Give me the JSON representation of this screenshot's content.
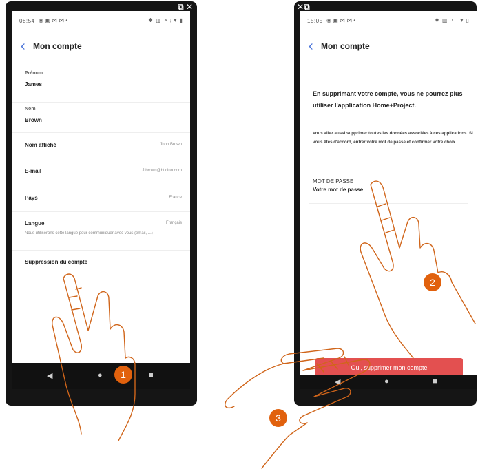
{
  "left_screen": {
    "status_time": "08:54",
    "header_title": "Mon compte",
    "fields": {
      "first_name_label": "Prénom",
      "first_name_value": "James",
      "last_name_label": "Nom",
      "last_name_value": "Brown",
      "display_name_label": "Nom affiché",
      "display_name_value": "Jhon Brown",
      "email_label": "E-mail",
      "email_value": "J.brown@bticino.com",
      "country_label": "Pays",
      "country_value": "France",
      "language_label": "Langue",
      "language_value": "Français",
      "language_note": "Nous utiliserons cette langue pour communiquer avec vous (email, ...)",
      "delete_account_label": "Suppression du compte"
    }
  },
  "right_screen": {
    "status_time": "15:05",
    "header_title": "Mon compte",
    "warning_title": "En supprimant votre compte, vous ne pourrez plus utiliser l'application Home+Project.",
    "warning_body": "Vous allez aussi supprimer toutes les données associées à ces applications. Si vous êtes d'accord, entrer votre mot de passe et confirmer votre choix.",
    "password_label": "MOT DE PASSE",
    "password_placeholder": "Votre mot de passe",
    "confirm_button": "Oui, supprimer mon compte"
  },
  "steps": [
    "1",
    "2",
    "3"
  ],
  "colors": {
    "accent_orange": "#e1610d",
    "delete_red": "#e35050",
    "back_blue": "#4a74d9",
    "hand_outline": "#d0651a"
  },
  "icons": [
    "back-chevron-icon",
    "nav-back-icon",
    "nav-home-icon",
    "nav-recent-icon",
    "expand-icon",
    "close-icon"
  ]
}
